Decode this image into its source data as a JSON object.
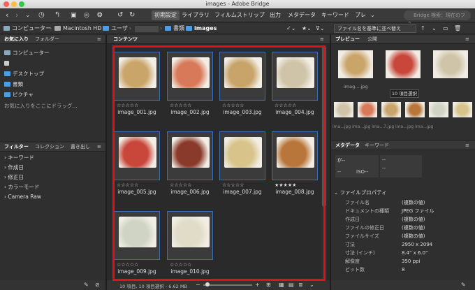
{
  "window": {
    "title": "images - Adobe Bridge"
  },
  "toolbar": {
    "workspaces": [
      "初期設定",
      "ライブラリ",
      "フィルムストリップ",
      "出力",
      "メタデータ",
      "キーワード",
      "プレ"
    ],
    "search_placeholder": "Bridge 検索：現在のフォ..."
  },
  "path": {
    "crumbs": [
      "コンピューター",
      "Macintosh HD",
      "ユーザ",
      "書類",
      "images"
    ],
    "sort_label": "ファイル名を基準に並べ替え"
  },
  "favorites": {
    "tabs": [
      "お気に入り",
      "フォルダー"
    ],
    "items": [
      "コンピューター",
      "デスクトップ",
      "書類",
      "ピクチャ"
    ],
    "drop_hint": "お気に入りをここにドラッグ..."
  },
  "filter": {
    "tabs": [
      "フィルター",
      "コレクション",
      "書き出し"
    ],
    "items": [
      "キーワード",
      "作成日",
      "修正日",
      "カラーモード",
      "Camera Raw"
    ]
  },
  "content": {
    "tab": "コンテンツ",
    "items": [
      {
        "name": "image_001.jpg",
        "stars": "☆☆☆☆☆",
        "color": "#c9a56a"
      },
      {
        "name": "image_002.jpg",
        "stars": "☆☆☆☆☆",
        "color": "#d87a5a"
      },
      {
        "name": "image_003.jpg",
        "stars": "☆☆☆☆☆",
        "color": "#c8a46a"
      },
      {
        "name": "image_004.jpg",
        "stars": "☆☆☆☆☆",
        "color": "#cfc4a8"
      },
      {
        "name": "image_005.jpg",
        "stars": "☆☆☆☆☆",
        "color": "#c8463a"
      },
      {
        "name": "image_006.jpg",
        "stars": "☆☆☆☆☆",
        "color": "#8a3a2a"
      },
      {
        "name": "image_007.jpg",
        "stars": "☆☆☆☆☆",
        "color": "#d8c48a"
      },
      {
        "name": "image_008.jpg",
        "stars": "★★★★★",
        "color": "#b8763a"
      },
      {
        "name": "image_009.jpg",
        "stars": "☆☆☆☆☆",
        "color": "#cfd4c4"
      },
      {
        "name": "image_010.jpg",
        "stars": "☆☆☆☆☆",
        "color": "#e0dcc8"
      }
    ],
    "status": "10 項目, 10 項目選択 - 6.62 MB"
  },
  "preview": {
    "tabs": [
      "プレビュー",
      "公開"
    ],
    "top_label": "imag....jpg",
    "tooltip": "10 項目選択",
    "strip_label": "ima...jpg ima...jpg ima...7.jpg ima...jpg ima...jpg",
    "thumb_colors": [
      "#e4e0d6",
      "#c9a56a",
      "#c8463a",
      "#cfc4a8",
      "#d87a5a",
      "#c8a46a",
      "#b8763a",
      "#cfd4c4",
      "#d8c48a",
      "#8a3a2a"
    ]
  },
  "metadata": {
    "tabs": [
      "メタデータ",
      "キーワード"
    ],
    "placard": {
      "f": "f/--",
      "dash": "--",
      "iso": "ISO--"
    },
    "section": "ファイルプロパティ",
    "rows": [
      {
        "k": "ファイル名",
        "v": "(複数の値)"
      },
      {
        "k": "ドキュメントの種類",
        "v": "JPEG ファイル"
      },
      {
        "k": "作成日",
        "v": "(複数の値)"
      },
      {
        "k": "ファイルの修正日",
        "v": "(複数の値)"
      },
      {
        "k": "ファイルサイズ",
        "v": "(複数の値)"
      },
      {
        "k": "寸法",
        "v": "2950 x 2094"
      },
      {
        "k": "寸法 (インチ)",
        "v": "8.4\" x 6.0\""
      },
      {
        "k": "解像度",
        "v": "350 ppi"
      },
      {
        "k": "ビット数",
        "v": "8"
      }
    ]
  },
  "colors": {
    "accent": "#e0111b",
    "selection": "#3a6fb8",
    "folder": "#4a9ee8"
  }
}
